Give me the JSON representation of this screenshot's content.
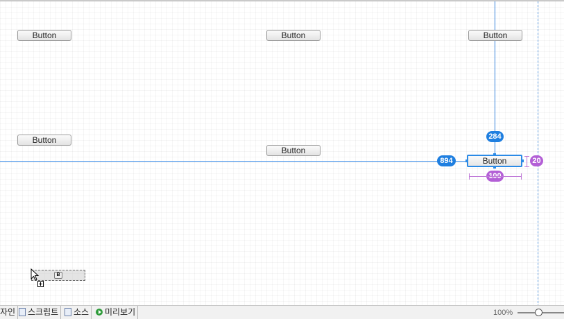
{
  "designer": {
    "buttons": [
      {
        "label": "Button"
      },
      {
        "label": "Button"
      },
      {
        "label": "Button"
      },
      {
        "label": "Button"
      },
      {
        "label": "Button"
      },
      {
        "label": "Button"
      }
    ],
    "measurements": {
      "top_distance": "284",
      "left_distance": "894",
      "height": "20",
      "width": "100"
    },
    "drag_ghost_glyph": "B"
  },
  "bottom_tabs": {
    "design": "자인",
    "script": "스크립트",
    "source": "소스",
    "preview": "미리보기"
  },
  "zoom": {
    "label": "100%",
    "level": 0.45
  },
  "colors": {
    "guide": "#3b8be6",
    "badge_blue": "#1f7fe0",
    "badge_purple": "#b35fd6"
  },
  "icons": [
    "document-icon",
    "play-icon",
    "mouse-cursor-icon",
    "add-icon"
  ]
}
